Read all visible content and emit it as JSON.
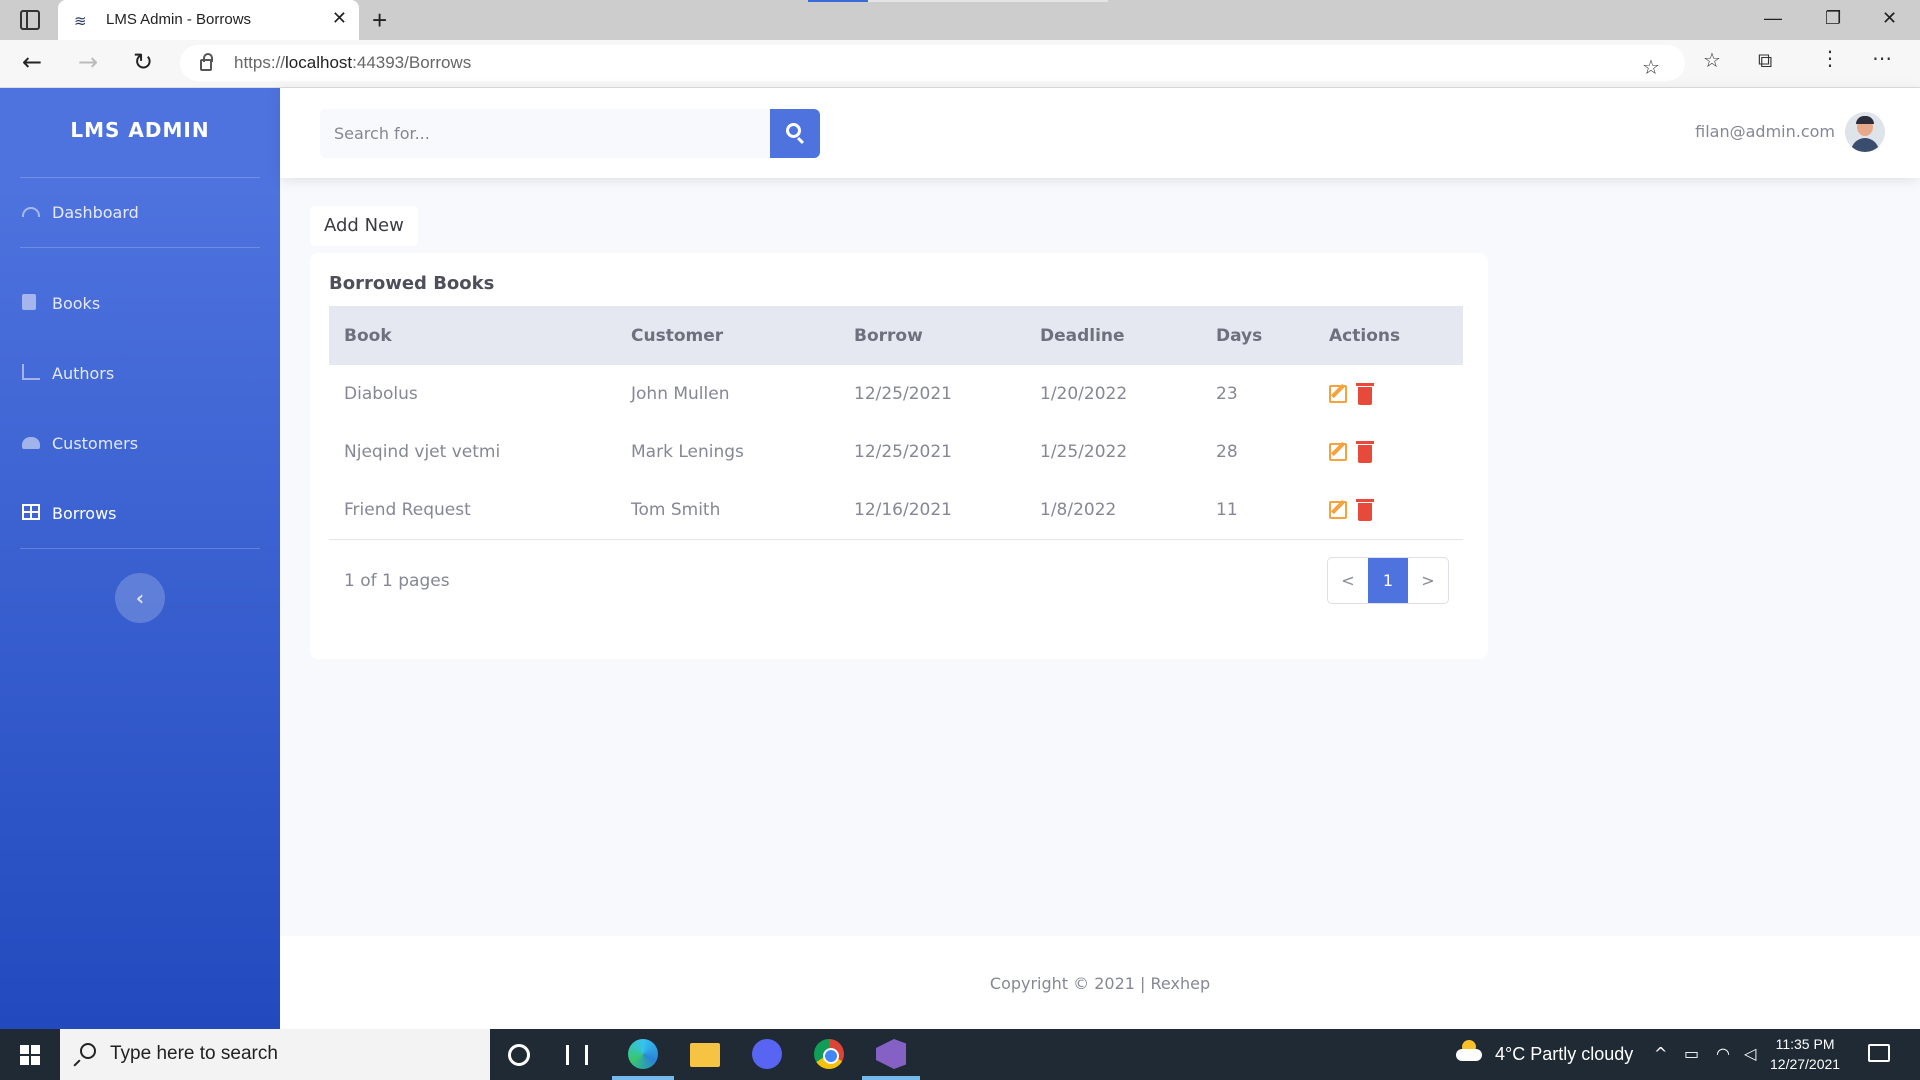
{
  "browser": {
    "tab_title": "LMS Admin - Borrows",
    "url_prefix": "https://",
    "url_host": "localhost",
    "url_rest": ":44393/Borrows"
  },
  "sidebar": {
    "brand": "LMS ADMIN",
    "items": [
      {
        "label": "Dashboard",
        "icon": "tachometer-icon"
      },
      {
        "label": "Books",
        "icon": "book-icon"
      },
      {
        "label": "Authors",
        "icon": "area-chart-icon"
      },
      {
        "label": "Customers",
        "icon": "users-icon"
      },
      {
        "label": "Borrows",
        "icon": "table-icon",
        "active": true
      }
    ],
    "toggle_glyph": "‹"
  },
  "topbar": {
    "search_placeholder": "Search for...",
    "user_email": "filan@admin.com"
  },
  "main": {
    "add_new_label": "Add New",
    "card_title": "Borrowed Books",
    "columns": [
      "Book",
      "Customer",
      "Borrow",
      "Deadline",
      "Days",
      "Actions"
    ],
    "rows": [
      {
        "book": "Diabolus",
        "customer": "John Mullen",
        "borrow": "12/25/2021",
        "deadline": "1/20/2022",
        "days": "23"
      },
      {
        "book": "Njeqind vjet vetmi",
        "customer": "Mark Lenings",
        "borrow": "12/25/2021",
        "deadline": "1/25/2022",
        "days": "28"
      },
      {
        "book": "Friend Request",
        "customer": "Tom Smith",
        "borrow": "12/16/2021",
        "deadline": "1/8/2022",
        "days": "11"
      }
    ],
    "pagination": {
      "summary": "1 of 1 pages",
      "prev": "<",
      "current": "1",
      "next": ">"
    }
  },
  "footer": {
    "text": "Copyright © 2021 | Rexhep"
  },
  "taskbar": {
    "search_placeholder": "Type here to search",
    "weather": "4°C  Partly cloudy",
    "time": "11:35 PM",
    "date": "12/27/2021"
  },
  "colors": {
    "primary": "#4e73df",
    "edit": "#f6a23e",
    "delete": "#e74a3b"
  }
}
